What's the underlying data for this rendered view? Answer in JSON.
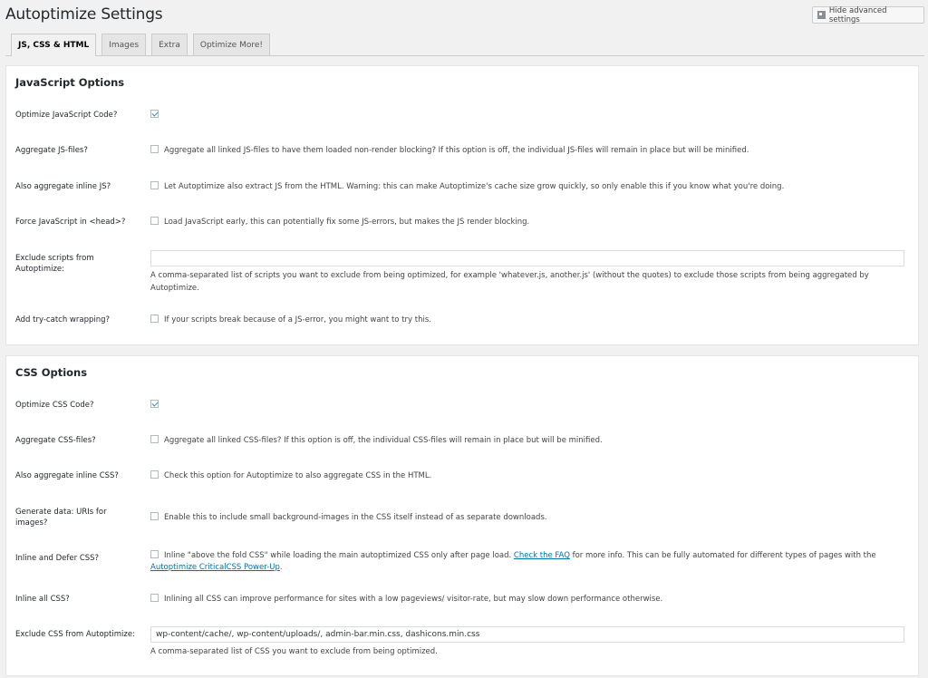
{
  "title": "Autoptimize Settings",
  "advanced_button": "Hide advanced settings",
  "tabs": [
    "JS, CSS & HTML",
    "Images",
    "Extra",
    "Optimize More!"
  ],
  "js": {
    "heading": "JavaScript Options",
    "optimize": {
      "label": "Optimize JavaScript Code?",
      "checked": true
    },
    "aggregate": {
      "label": "Aggregate JS-files?",
      "text": "Aggregate all linked JS-files to have them loaded non-render blocking? If this option is off, the individual JS-files will remain in place but will be minified."
    },
    "inline": {
      "label": "Also aggregate inline JS?",
      "text": "Let Autoptimize also extract JS from the HTML. Warning: this can make Autoptimize's cache size grow quickly, so only enable this if you know what you're doing."
    },
    "force_head": {
      "label": "Force JavaScript in <head>?",
      "text": "Load JavaScript early, this can potentially fix some JS-errors, but makes the JS render blocking."
    },
    "exclude": {
      "label_line1": "Exclude scripts from",
      "label_line2": "Autoptimize:",
      "value": "",
      "desc": "A comma-separated list of scripts you want to exclude from being optimized, for example 'whatever.js, another.js' (without the quotes) to exclude those scripts from being aggregated by Autoptimize."
    },
    "trycatch": {
      "label": "Add try-catch wrapping?",
      "text": "If your scripts break because of a JS-error, you might want to try this."
    }
  },
  "css": {
    "heading": "CSS Options",
    "optimize": {
      "label": "Optimize CSS Code?",
      "checked": true
    },
    "aggregate": {
      "label": "Aggregate CSS-files?",
      "text": "Aggregate all linked CSS-files? If this option is off, the individual CSS-files will remain in place but will be minified."
    },
    "inline": {
      "label": "Also aggregate inline CSS?",
      "text": "Check this option for Autoptimize to also aggregate CSS in the HTML."
    },
    "datauri": {
      "label_line1": "Generate data: URIs for",
      "label_line2": "images?",
      "text": "Enable this to include small background-images in the CSS itself instead of as separate downloads."
    },
    "defer": {
      "label": "Inline and Defer CSS?",
      "text_a": "Inline \"above the fold CSS\" while loading the main autoptimized CSS only after page load.",
      "link_faq": "Check the FAQ",
      "text_b": "for more info. This can be fully automated for different types of pages with the",
      "link_powerup": "Autoptimize CriticalCSS Power-Up",
      "text_c": "."
    },
    "inline_all": {
      "label": "Inline all CSS?",
      "text": "Inlining all CSS can improve performance for sites with a low pageviews/ visitor-rate, but may slow down performance otherwise."
    },
    "exclude": {
      "label": "Exclude CSS from Autoptimize:",
      "value": "wp-content/cache/, wp-content/uploads/, admin-bar.min.css, dashicons.min.css",
      "desc": "A comma-separated list of CSS you want to exclude from being optimized."
    }
  }
}
